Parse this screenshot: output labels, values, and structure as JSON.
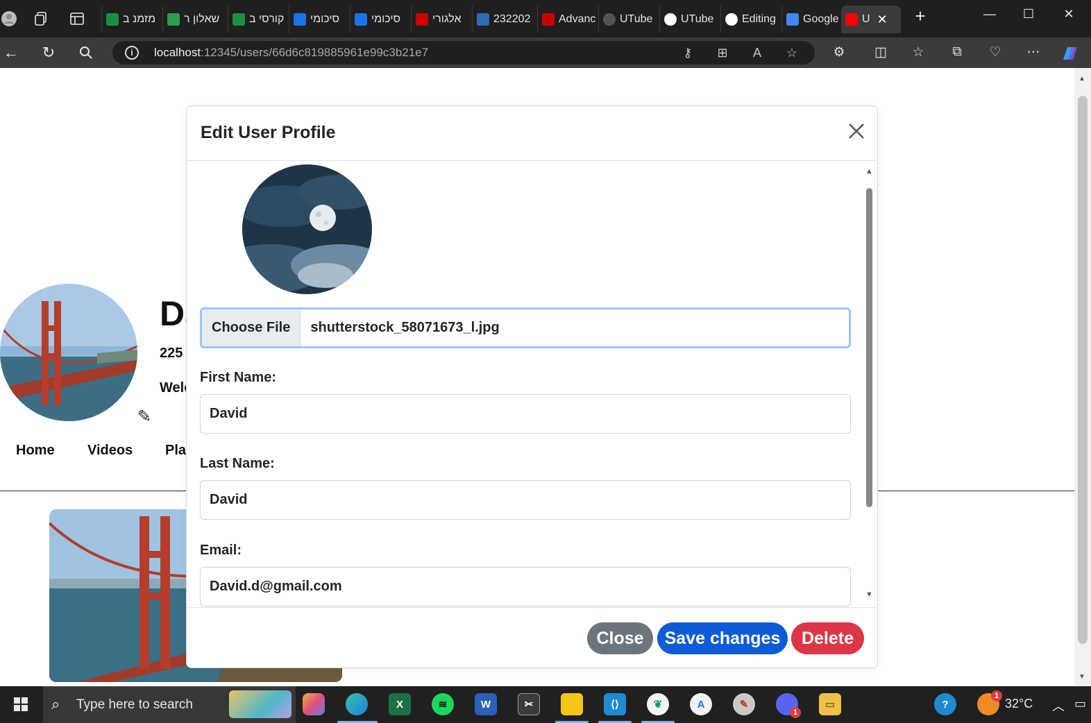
{
  "browser": {
    "tabs": [
      {
        "label": "מזמנ ב",
        "color": "#1e8e3e"
      },
      {
        "label": "שאלון ר",
        "color": "#2e9e4e"
      },
      {
        "label": "קורסי ב",
        "color": "#1e8e3e"
      },
      {
        "label": "סיכומי",
        "color": "#1a73e8"
      },
      {
        "label": "סיכומי",
        "color": "#1a73e8"
      },
      {
        "label": "אלגורי",
        "color": "#cc0000"
      },
      {
        "label": "232202",
        "color": "#2d6db5"
      },
      {
        "label": "Advanc",
        "color": "#cc0000"
      },
      {
        "label": "UTube",
        "color": "#555555"
      },
      {
        "label": "UTube",
        "color": "#ffffff"
      },
      {
        "label": "Editing",
        "color": "#ffffff"
      },
      {
        "label": "Google",
        "color": "#4285f4"
      }
    ],
    "active_tab": {
      "label": "U",
      "color": "#ff0000"
    },
    "url_host": "localhost",
    "url_rest": ":12345/users/66d6c819885961e99c3b21e7"
  },
  "page": {
    "user_name": "Da",
    "subscribers": "225",
    "welcome": "Welc",
    "nav": [
      "Home",
      "Videos",
      "Pla"
    ]
  },
  "modal": {
    "title": "Edit User Profile",
    "choose_file": "Choose File",
    "file_name": "shutterstock_58071673_l.jpg",
    "first_name_label": "First Name:",
    "first_name_value": "David",
    "last_name_label": "Last Name:",
    "last_name_value": "David",
    "email_label": "Email:",
    "email_value": "David.d@gmail.com",
    "buttons": {
      "close": "Close",
      "save": "Save changes",
      "delete": "Delete"
    },
    "colors": {
      "close": "#6c757d",
      "save": "#0d5bd7",
      "delete": "#dc3545"
    }
  },
  "taskbar": {
    "search_placeholder": "Type here to search",
    "temperature": "32°C",
    "weather_badge": "1",
    "discord_badge": "1"
  }
}
